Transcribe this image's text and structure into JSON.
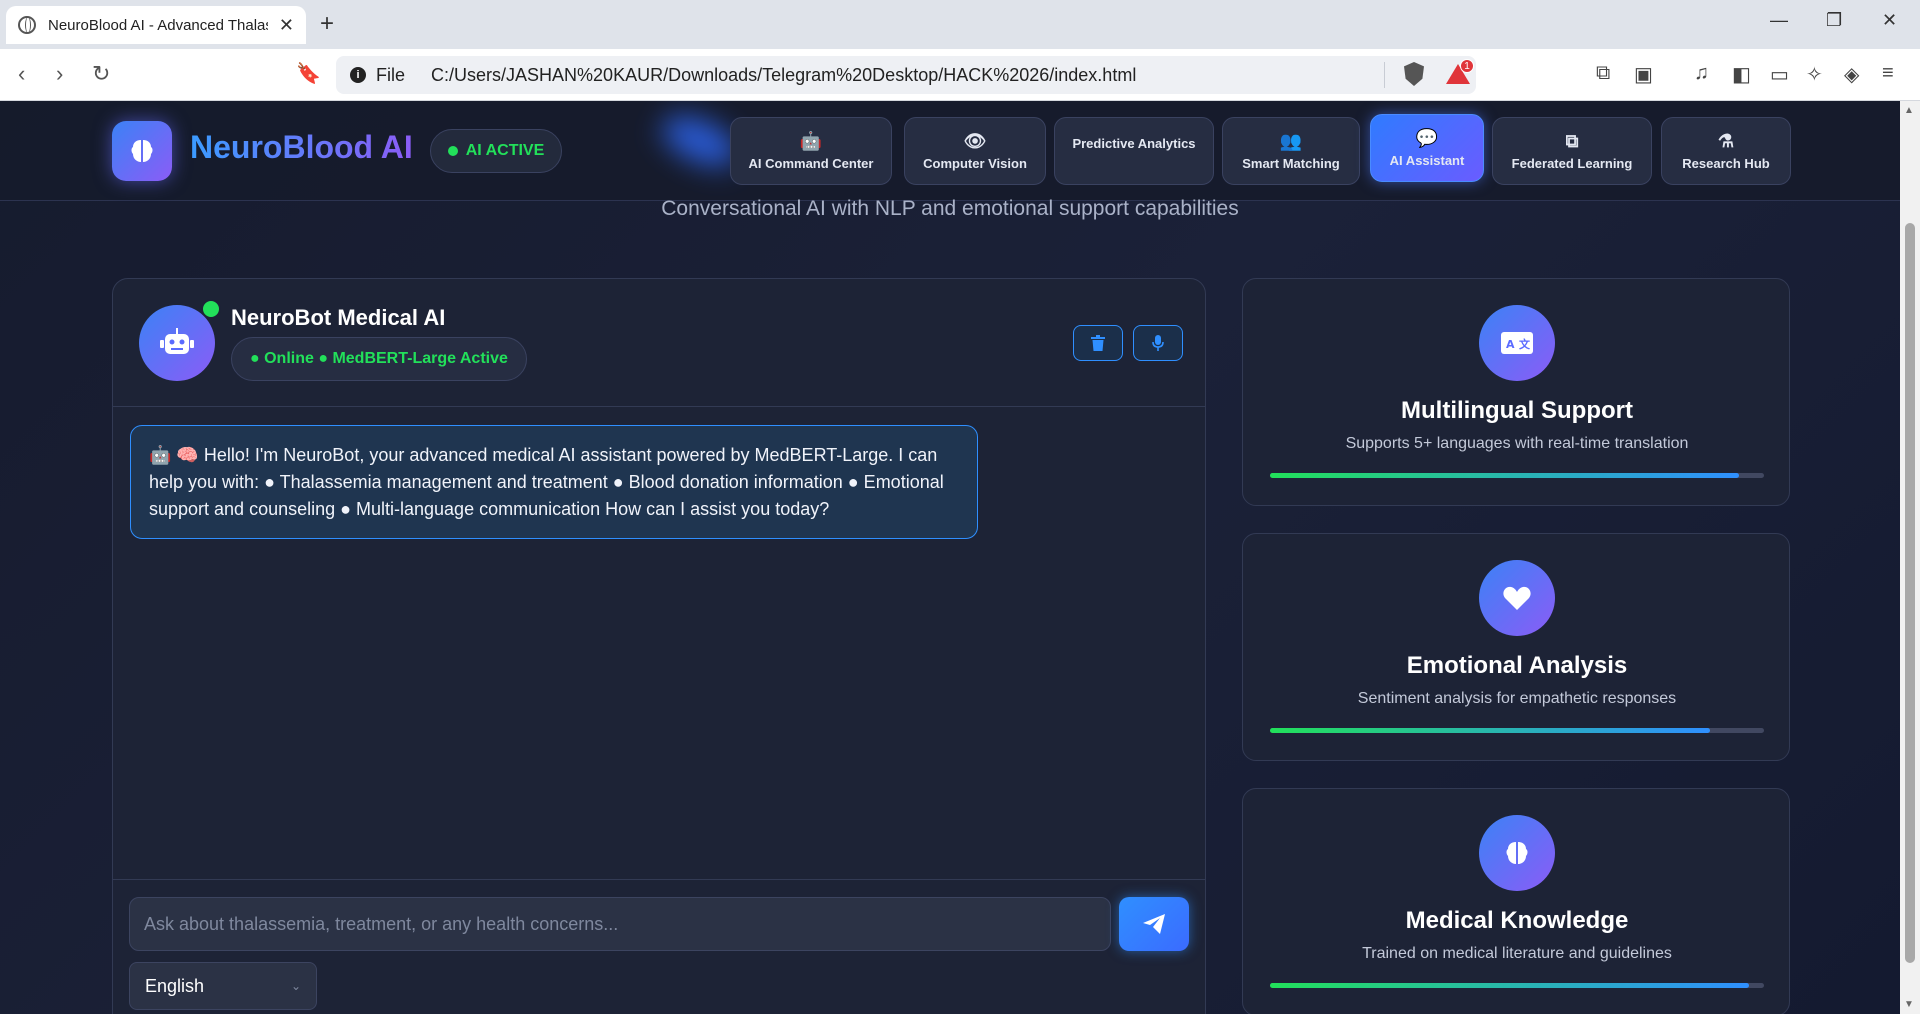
{
  "browser": {
    "tab_title": "NeuroBlood AI - Advanced Thalassemia",
    "tab_close": "✕",
    "new_tab": "+",
    "url_scheme": "File",
    "url": "C:/Users/JASHAN%20KAUR/Downloads/Telegram%20Desktop/HACK%2026/index.html",
    "brave_badge": "1"
  },
  "header": {
    "app_name": "NeuroBlood AI",
    "status_badge": "AI ACTIVE",
    "nav": [
      {
        "label": "AI Command Center",
        "icon": "robot-icon",
        "glyph": "🤖"
      },
      {
        "label": "Computer Vision",
        "icon": "eye-icon",
        "glyph": "👁"
      },
      {
        "label": "Predictive Analytics",
        "icon": "",
        "glyph": ""
      },
      {
        "label": "Smart Matching",
        "icon": "users-icon",
        "glyph": "👥"
      },
      {
        "label": "AI Assistant",
        "icon": "comments-icon",
        "glyph": "💬"
      },
      {
        "label": "Federated Learning",
        "icon": "network-icon",
        "glyph": "⧉"
      },
      {
        "label": "Research Hub",
        "icon": "flask-icon",
        "glyph": "⚗"
      }
    ],
    "active_nav": "AI Assistant"
  },
  "subtitle": "Conversational AI with NLP and emotional support capabilities",
  "chat": {
    "bot_name": "NeuroBot Medical AI",
    "bot_status": "● Online ● MedBERT-Large Active",
    "message": "🤖 🧠 Hello! I'm NeuroBot, your advanced medical AI assistant powered by MedBERT-Large. I can help you with: ● Thalassemia management and treatment ● Blood donation information ● Emotional support and counseling ● Multi-language communication How can I assist you today?",
    "input_placeholder": "Ask about thalassemia, treatment, or any health concerns...",
    "input_value": "",
    "language_selected": "English"
  },
  "features": [
    {
      "title": "Multilingual Support",
      "description": "Supports 5+ languages with real-time translation",
      "icon": "language-icon",
      "progress": 0.95
    },
    {
      "title": "Emotional Analysis",
      "description": "Sentiment analysis for empathetic responses",
      "icon": "heart-icon",
      "progress": 0.89
    },
    {
      "title": "Medical Knowledge",
      "description": "Trained on medical literature and guidelines",
      "icon": "brain-icon",
      "progress": 0.97
    }
  ],
  "colors": {
    "accent_blue": "#2f8fff",
    "accent_purple": "#8b5cf6",
    "status_green": "#22e05a",
    "panel_bg": "#1d2336"
  }
}
